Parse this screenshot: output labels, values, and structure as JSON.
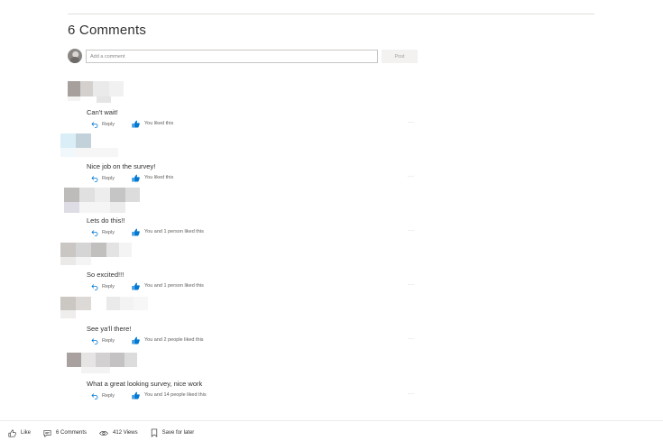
{
  "comments_heading": "6 Comments",
  "composer": {
    "placeholder": "Add a comment",
    "post_label": "Post"
  },
  "reply_label": "Reply",
  "more_label": "···",
  "comments": [
    {
      "text": "Can't wait!",
      "likes": "You liked this"
    },
    {
      "text": "Nice job on the survey!",
      "likes": "You liked this"
    },
    {
      "text": "Lets do this!!",
      "likes": "You and 1 person liked this"
    },
    {
      "text": "So excited!!!",
      "likes": "You and 1 person liked this"
    },
    {
      "text": "See ya'll there!",
      "likes": "You and 2 people liked this"
    },
    {
      "text": "What a great looking survey, nice work",
      "likes": "You and 14 people liked this"
    }
  ],
  "footer": {
    "like": "Like",
    "comments": "6 Comments",
    "views": "412 Views",
    "save": "Save for later"
  },
  "colors": {
    "accent": "#0078d4",
    "text": "#323130",
    "muted": "#605e5c",
    "divider": "#e1dfdd"
  }
}
